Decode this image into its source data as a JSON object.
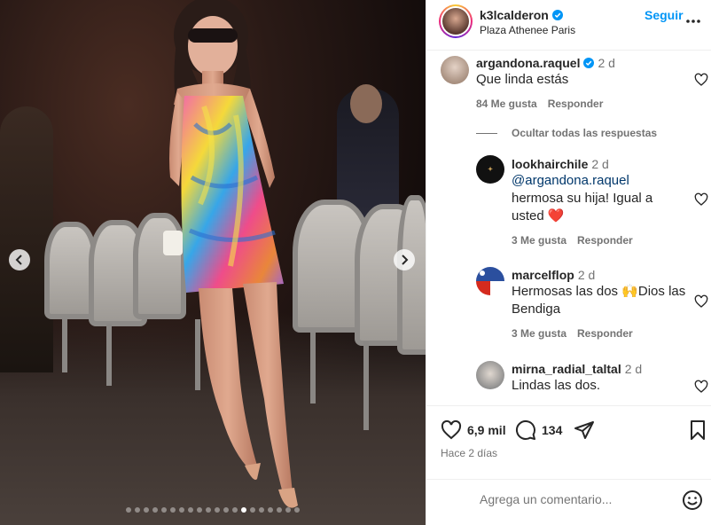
{
  "post": {
    "username": "k3lcalderon",
    "location": "Plaza Athenee Paris",
    "follow_label": "Seguir",
    "verified": true
  },
  "carousel": {
    "total_slides": 20,
    "active_slide": 14
  },
  "comments": [
    {
      "username": "argandona.raquel",
      "verified": true,
      "time": "2 d",
      "text": "Que linda estás",
      "likes_label": "84 Me gusta",
      "reply_label": "Responder"
    },
    {
      "hide_replies_label": "Ocultar todas las respuestas"
    },
    {
      "username": "lookhairchile",
      "time": "2 d",
      "mention": "@argandona.raquel",
      "text": "hermosa su hija! Igual a usted ❤️",
      "likes_label": "3 Me gusta",
      "reply_label": "Responder"
    },
    {
      "username": "marcelflop",
      "time": "2 d",
      "text": "Hermosas las dos 🙌Dios las Bendiga",
      "likes_label": "3 Me gusta",
      "reply_label": "Responder"
    },
    {
      "username": "mirna_radial_taltal",
      "time": "2 d",
      "text": "Lindas las dos."
    }
  ],
  "actions": {
    "likes": "6,9 mil",
    "comments_count": "134",
    "posted_ago": "Hace 2 días"
  },
  "add_comment": {
    "placeholder": "Agrega un comentario..."
  },
  "colors": {
    "accent": "#0095f6",
    "verified": "#0095f6",
    "mention": "#00376b",
    "muted": "#737373"
  }
}
